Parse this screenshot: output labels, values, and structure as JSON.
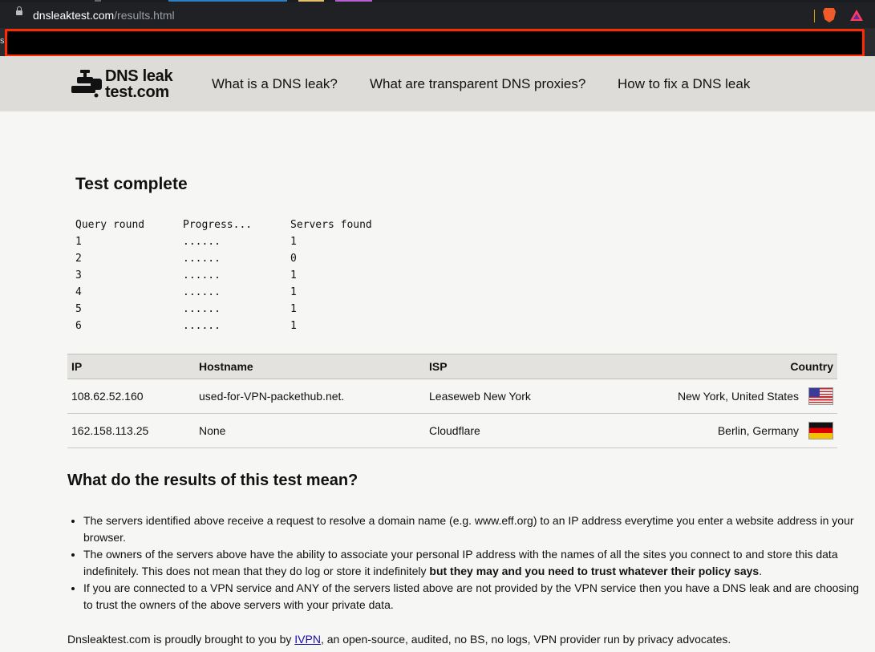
{
  "browser": {
    "url_domain": "dnsleaktest.com",
    "url_path": "/results.html",
    "bookmark_fragment": "s"
  },
  "logo": {
    "line1": "DNS leak",
    "line2": "test.com"
  },
  "nav": {
    "items": [
      "What is a DNS leak?",
      "What are transparent DNS proxies?",
      "How to fix a DNS leak"
    ]
  },
  "test": {
    "heading": "Test complete",
    "headers": [
      "Query round",
      "Progress...",
      "Servers found"
    ],
    "rounds": [
      {
        "round": "1",
        "progress": "......",
        "servers": "1"
      },
      {
        "round": "2",
        "progress": "......",
        "servers": "0"
      },
      {
        "round": "3",
        "progress": "......",
        "servers": "1"
      },
      {
        "round": "4",
        "progress": "......",
        "servers": "1"
      },
      {
        "round": "5",
        "progress": "......",
        "servers": "1"
      },
      {
        "round": "6",
        "progress": "......",
        "servers": "1"
      }
    ]
  },
  "results": {
    "headers": [
      "IP",
      "Hostname",
      "ISP",
      "Country"
    ],
    "rows": [
      {
        "ip": "108.62.52.160",
        "hostname": "used-for-VPN-packethub.net.",
        "isp": "Leaseweb New York",
        "country": "New York, United States",
        "flag": "us-flag-icon"
      },
      {
        "ip": "162.158.113.25",
        "hostname": "None",
        "isp": "Cloudflare",
        "country": "Berlin, Germany",
        "flag": "de-flag-icon"
      }
    ]
  },
  "meaning": {
    "heading": "What do the results of this test mean?",
    "bullet1": "The servers identified above receive a request to resolve a domain name (e.g. www.eff.org) to an IP address everytime you enter a website address in your browser.",
    "bullet2_pre": "The owners of the servers above have the ability to associate your personal IP address with the names of all the sites you connect to and store this data indefinitely. This does not mean that they do log or store it indefinitely ",
    "bullet2_bold": "but they may and you need to trust whatever their policy says",
    "bullet2_post": ".",
    "bullet3": "If you are connected to a VPN service and ANY of the servers listed above are not provided by the VPN service then you have a DNS leak and are choosing to trust the owners of the above servers with your private data."
  },
  "footer": {
    "pre": "Dnsleaktest.com is proudly brought to you by ",
    "link": "IVPN",
    "post": ", an open-source, audited, no BS, no logs, VPN provider run by privacy advocates."
  },
  "colors": {
    "accent_redaction_border": "#ff2a00",
    "link": "#1a0dab",
    "header_bg": "#dddcd8"
  }
}
